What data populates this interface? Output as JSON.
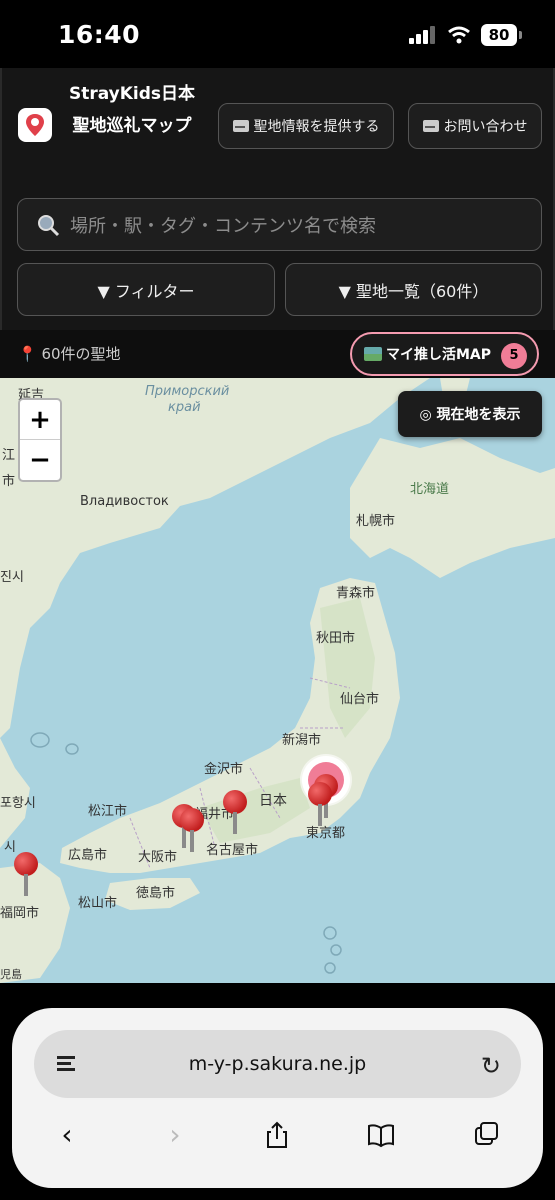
{
  "status_bar": {
    "time": "16:40",
    "battery": "80"
  },
  "header": {
    "title": "StrayKids日本聖地巡礼マップ",
    "provide_button": "聖地情報を提供する",
    "contact_button": "お問い合わせ"
  },
  "search": {
    "placeholder": "場所・駅・タグ・コンテンツ名で検索"
  },
  "filters": {
    "filter_label": "▼ フィルター",
    "list_label": "▼ 聖地一覧（60件）"
  },
  "count_bar": {
    "count_text": "60件の聖地",
    "mymap_label": "マイ推し活MAP",
    "mymap_badge": "5"
  },
  "map": {
    "zoom_in": "+",
    "zoom_out": "−",
    "locate_label": "◎ 現在地を表示",
    "labels": {
      "primorsky": "Приморский",
      "krai": "край",
      "vladivostok": "Владивосток",
      "hokkaido": "北海道",
      "sapporo": "札幌市",
      "aomori": "青森市",
      "akita": "秋田市",
      "sendai": "仙台市",
      "niigata": "新潟市",
      "kanazawa": "金沢市",
      "nihon": "日本",
      "tokyo": "東京都",
      "fukui": "福井市",
      "nagoya": "名古屋市",
      "matsue": "松江市",
      "osaka": "大阪市",
      "hiroshima": "広島市",
      "tokushima": "徳島市",
      "matsuyama": "松山市",
      "fukuoka": "福岡市",
      "left1": "延吉",
      "left2": "江",
      "left3": "市",
      "left4": "진시",
      "left5": "포항시",
      "left6": "시",
      "left7": "児島"
    }
  },
  "browser": {
    "url": "m-y-p.sakura.ne.jp"
  },
  "colors": {
    "accent_pink": "#f49bb0",
    "pin_red": "#c11d1d",
    "sea": "#aad3df",
    "land": "#e7ecdf"
  }
}
